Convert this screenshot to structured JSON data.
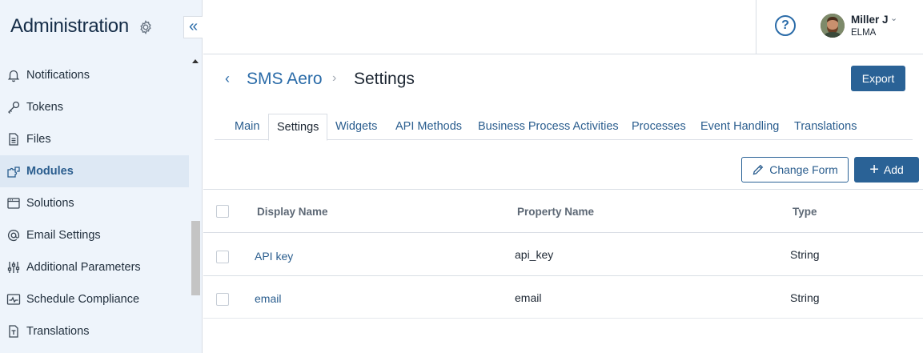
{
  "sidebar": {
    "title": "Administration",
    "items": [
      {
        "label": "Notifications",
        "icon": "bell-icon"
      },
      {
        "label": "Tokens",
        "icon": "key-icon"
      },
      {
        "label": "Files",
        "icon": "file-icon"
      },
      {
        "label": "Modules",
        "icon": "puzzle-icon",
        "active": true
      },
      {
        "label": "Solutions",
        "icon": "window-icon"
      },
      {
        "label": "Email Settings",
        "icon": "at-icon"
      },
      {
        "label": "Additional Parameters",
        "icon": "sliders-icon"
      },
      {
        "label": "Schedule Compliance",
        "icon": "pulse-icon"
      },
      {
        "label": "Translations",
        "icon": "translate-icon"
      }
    ]
  },
  "topbar": {
    "help_icon": "?",
    "user": {
      "name": "Miller J",
      "org": "ELMA"
    }
  },
  "header": {
    "breadcrumb": "SMS Aero",
    "title": "Settings",
    "export_label": "Export"
  },
  "tabs": [
    "Main",
    "Settings",
    "Widgets",
    "API Methods",
    "Business Process Activities",
    "Processes",
    "Event Handling",
    "Translations"
  ],
  "active_tab": "Settings",
  "actions": {
    "change_form": "Change Form",
    "add": "Add"
  },
  "table": {
    "columns": [
      "Display Name",
      "Property Name",
      "Type"
    ],
    "rows": [
      {
        "display": "API key",
        "property": "api_key",
        "type": "String"
      },
      {
        "display": "email",
        "property": "email",
        "type": "String"
      }
    ]
  },
  "colors": {
    "accent": "#2a6296",
    "link": "#2a5d8e",
    "sidebar_bg": "#eef4fb"
  }
}
